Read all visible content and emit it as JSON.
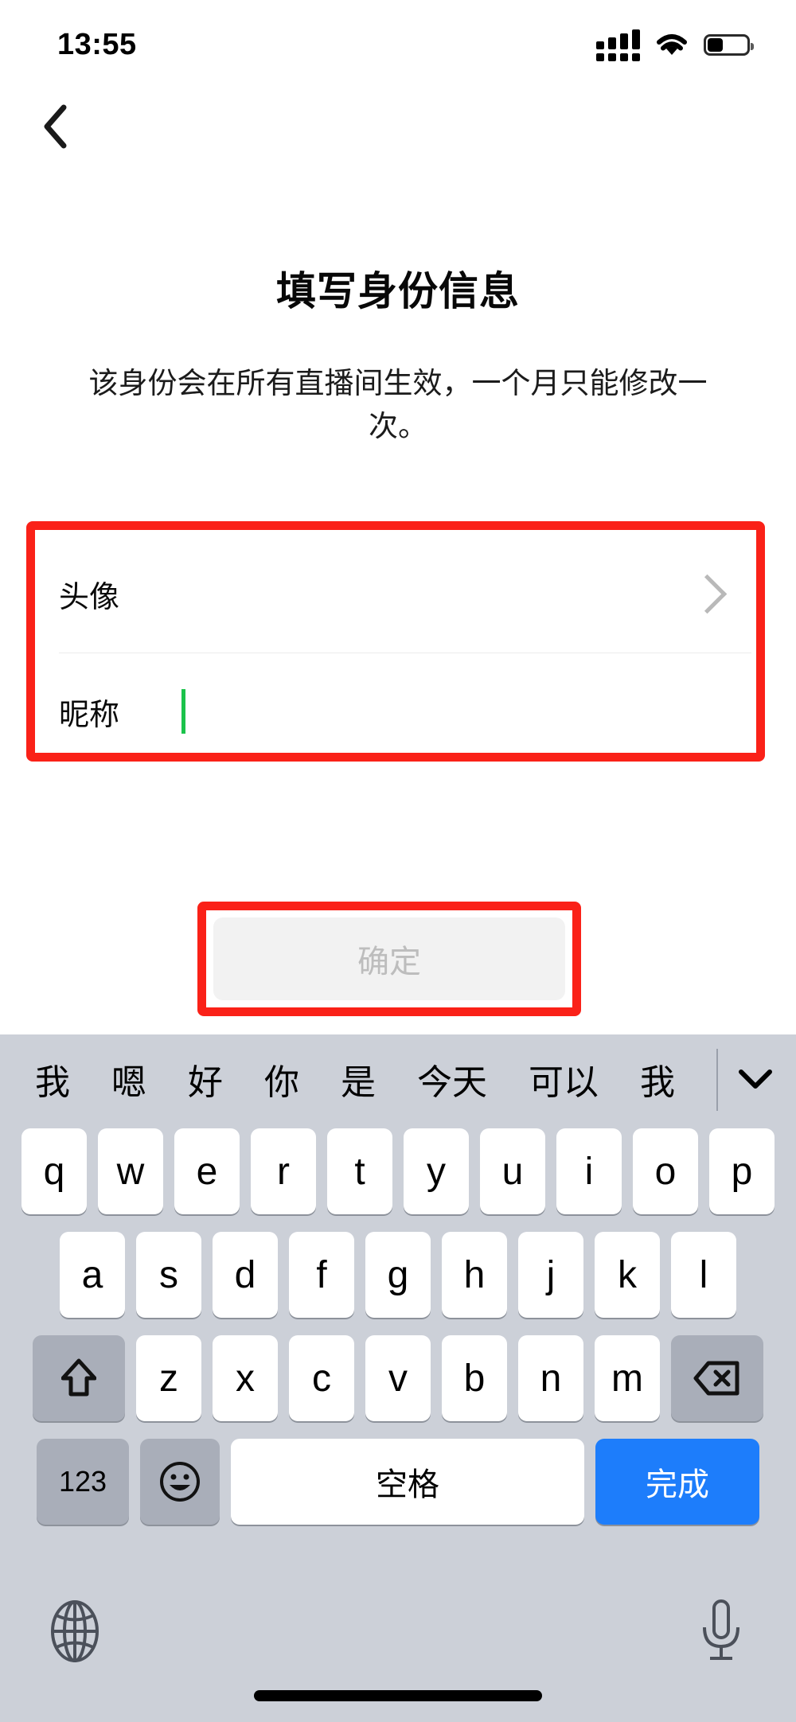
{
  "status_bar": {
    "time": "13:55",
    "signal_icon": "signal-bars-icon",
    "wifi_icon": "wifi-icon",
    "battery_icon": "battery-icon",
    "battery_level_pct": 40
  },
  "nav": {
    "back_icon": "chevron-left-icon"
  },
  "header": {
    "title": "填写身份信息",
    "subtitle": "该身份会在所有直播间生效，一个月只能修改一次。"
  },
  "form": {
    "rows": [
      {
        "label": "头像",
        "value": "",
        "accessory": "chevron-right-icon",
        "type": "navigation"
      },
      {
        "label": "昵称",
        "value": "",
        "accessory": "text-caret",
        "type": "text-input",
        "caret_color": "#1bc34b"
      }
    ]
  },
  "submit": {
    "label": "确定",
    "enabled": false,
    "background": "#f2f2f2",
    "text_color": "#bdbdbd"
  },
  "highlights": {
    "color": "#fa2118",
    "boxes": [
      "form-card",
      "submit-button"
    ]
  },
  "keyboard": {
    "suggestions": [
      "我",
      "嗯",
      "好",
      "你",
      "是",
      "今天",
      "可以",
      "我"
    ],
    "expand_icon": "chevron-down-icon",
    "rows": [
      [
        "q",
        "w",
        "e",
        "r",
        "t",
        "y",
        "u",
        "i",
        "o",
        "p"
      ],
      [
        "a",
        "s",
        "d",
        "f",
        "g",
        "h",
        "j",
        "k",
        "l"
      ],
      [
        "z",
        "x",
        "c",
        "v",
        "b",
        "n",
        "m"
      ]
    ],
    "shift_key": {
      "icon": "shift-up-arrow-icon",
      "label": ""
    },
    "backspace_key": {
      "icon": "backspace-delete-icon",
      "label": ""
    },
    "bottom_row": {
      "numeric_label": "123",
      "emoji_icon": "emoji-smiley-icon",
      "space_label": "空格",
      "done_label": "完成",
      "done_color": "#1d7dfb"
    },
    "globe_icon": "globe-language-icon",
    "mic_icon": "microphone-icon",
    "home_indicator": "home-indicator-bar",
    "background": "#ccd0d8"
  }
}
